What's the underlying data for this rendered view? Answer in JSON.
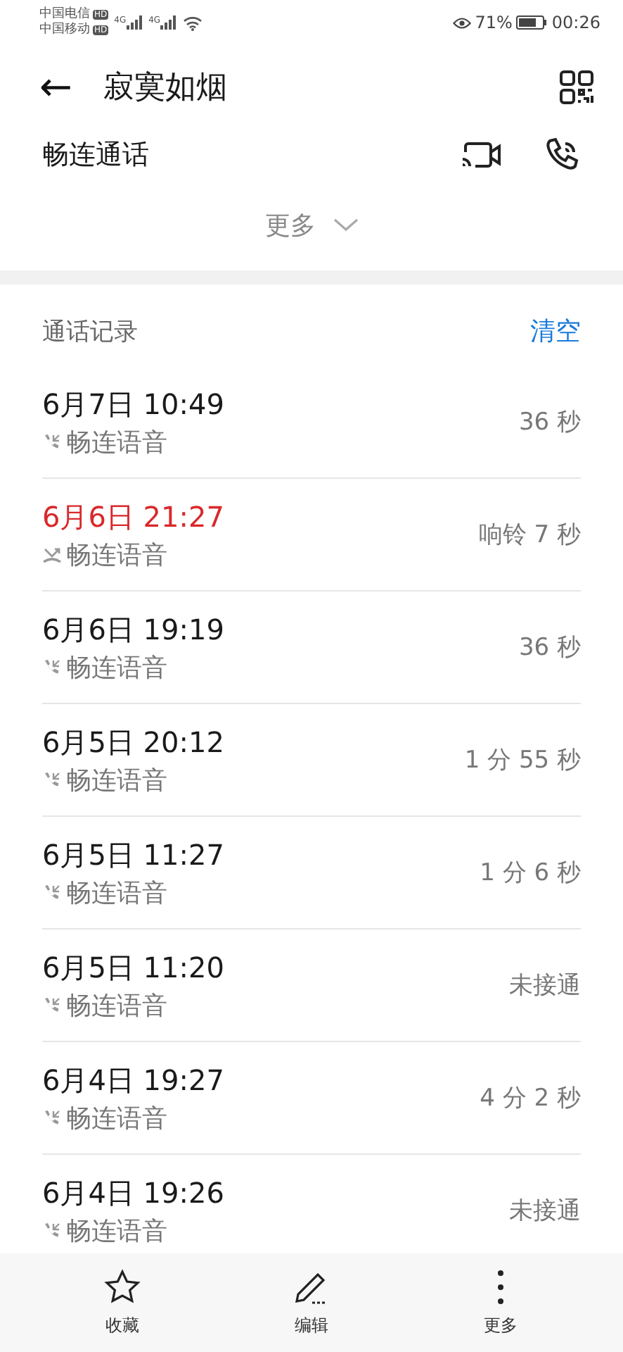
{
  "status_bar": {
    "carriers": [
      {
        "name": "中国电信",
        "badge": "HD"
      },
      {
        "name": "中国移动",
        "badge": "HD"
      }
    ],
    "networks": [
      "4G",
      "4G"
    ],
    "battery_percent": "71%",
    "time": "00:26"
  },
  "header": {
    "back": "←",
    "title": "寂寞如烟"
  },
  "service": {
    "label": "畅连通话"
  },
  "more": {
    "label": "更多"
  },
  "call_log": {
    "title": "通话记录",
    "clear": "清空",
    "rows": [
      {
        "datetime": "6月7日 10:49",
        "type": "畅连语音",
        "duration": "36 秒",
        "missed": false
      },
      {
        "datetime": "6月6日 21:27",
        "type": "畅连语音",
        "duration": "响铃 7 秒",
        "missed": true
      },
      {
        "datetime": "6月6日 19:19",
        "type": "畅连语音",
        "duration": "36 秒",
        "missed": false
      },
      {
        "datetime": "6月5日 20:12",
        "type": "畅连语音",
        "duration": "1 分 55 秒",
        "missed": false
      },
      {
        "datetime": "6月5日 11:27",
        "type": "畅连语音",
        "duration": "1 分 6 秒",
        "missed": false
      },
      {
        "datetime": "6月5日 11:20",
        "type": "畅连语音",
        "duration": "未接通",
        "missed": false
      },
      {
        "datetime": "6月4日 19:27",
        "type": "畅连语音",
        "duration": "4 分 2 秒",
        "missed": false
      },
      {
        "datetime": "6月4日 19:26",
        "type": "畅连语音",
        "duration": "未接通",
        "missed": false
      }
    ]
  },
  "bottom_bar": [
    {
      "kind": "star",
      "label": "收藏"
    },
    {
      "kind": "pencil",
      "label": "编辑"
    },
    {
      "kind": "dots",
      "label": "更多"
    }
  ]
}
